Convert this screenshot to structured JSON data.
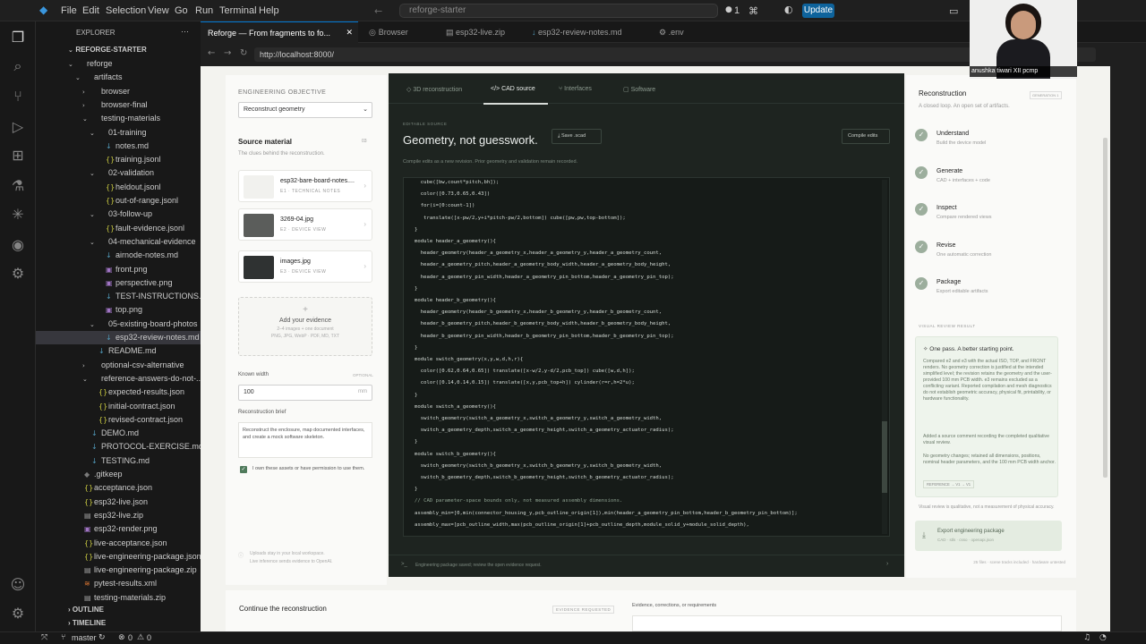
{
  "titlebar": {
    "menu": [
      "File",
      "Edit",
      "Selection",
      "View",
      "Go",
      "Run",
      "Terminal",
      "Help"
    ],
    "search": "reforge-starter",
    "badge": "1",
    "update": "Update"
  },
  "tabs": [
    {
      "label": "Reforge — From fragments to fo...",
      "active": true
    },
    {
      "label": "Browser",
      "active": false
    },
    {
      "label": "esp32-live.zip",
      "active": false
    },
    {
      "label": "esp32-review-notes.md",
      "active": false
    },
    {
      "label": ".env",
      "active": false
    }
  ],
  "browser": {
    "url": "http://localhost:8000/"
  },
  "explorer": {
    "title": "EXPLORER",
    "root": "REFORGE-STARTER",
    "items": [
      {
        "label": "reforge",
        "tw": "⌄",
        "icon": "",
        "indent": 0
      },
      {
        "label": "artifacts",
        "tw": "⌄",
        "icon": "",
        "indent": 1
      },
      {
        "label": "browser",
        "tw": "›",
        "icon": "",
        "indent": 2
      },
      {
        "label": "browser-final",
        "tw": "›",
        "icon": "",
        "indent": 2
      },
      {
        "label": "testing-materials",
        "tw": "⌄",
        "icon": "",
        "indent": 2
      },
      {
        "label": "01-training",
        "tw": "⌄",
        "icon": "",
        "indent": 3
      },
      {
        "label": "notes.md",
        "tw": "",
        "icon": "↓",
        "indent": 4
      },
      {
        "label": "training.jsonl",
        "tw": "",
        "icon": "{}",
        "indent": 4
      },
      {
        "label": "02-validation",
        "tw": "⌄",
        "icon": "",
        "indent": 3
      },
      {
        "label": "heldout.jsonl",
        "tw": "",
        "icon": "{}",
        "indent": 4
      },
      {
        "label": "out-of-range.jsonl",
        "tw": "",
        "icon": "{}",
        "indent": 4
      },
      {
        "label": "03-follow-up",
        "tw": "⌄",
        "icon": "",
        "indent": 3
      },
      {
        "label": "fault-evidence.jsonl",
        "tw": "",
        "icon": "{}",
        "indent": 4
      },
      {
        "label": "04-mechanical-evidence",
        "tw": "⌄",
        "icon": "",
        "indent": 3
      },
      {
        "label": "airnode-notes.md",
        "tw": "",
        "icon": "↓",
        "indent": 4
      },
      {
        "label": "front.png",
        "tw": "",
        "icon": "▣",
        "indent": 4
      },
      {
        "label": "perspective.png",
        "tw": "",
        "icon": "▣",
        "indent": 4
      },
      {
        "label": "TEST-INSTRUCTIONS.md",
        "tw": "",
        "icon": "↓",
        "indent": 4
      },
      {
        "label": "top.png",
        "tw": "",
        "icon": "▣",
        "indent": 4
      },
      {
        "label": "05-existing-board-photos",
        "tw": "⌄",
        "icon": "",
        "indent": 3
      },
      {
        "label": "esp32-review-notes.md",
        "tw": "",
        "icon": "↓",
        "indent": 4,
        "selected": true
      },
      {
        "label": "README.md",
        "tw": "",
        "icon": "↓",
        "indent": 3
      },
      {
        "label": "optional-csv-alternative",
        "tw": "›",
        "icon": "",
        "indent": 2
      },
      {
        "label": "reference-answers-do-not-...",
        "tw": "⌄",
        "icon": "",
        "indent": 2
      },
      {
        "label": "expected-results.json",
        "tw": "",
        "icon": "{}",
        "indent": 3
      },
      {
        "label": "initial-contract.json",
        "tw": "",
        "icon": "{}",
        "indent": 3
      },
      {
        "label": "revised-contract.json",
        "tw": "",
        "icon": "{}",
        "indent": 3
      },
      {
        "label": "DEMO.md",
        "tw": "",
        "icon": "↓",
        "indent": 2
      },
      {
        "label": "PROTOCOL-EXERCISE.md",
        "tw": "",
        "icon": "↓",
        "indent": 2
      },
      {
        "label": "TESTING.md",
        "tw": "",
        "icon": "↓",
        "indent": 2
      },
      {
        "label": ".gitkeep",
        "tw": "",
        "icon": "◆",
        "indent": 1
      },
      {
        "label": "acceptance.json",
        "tw": "",
        "icon": "{}",
        "indent": 1
      },
      {
        "label": "esp32-live.json",
        "tw": "",
        "icon": "{}",
        "indent": 1
      },
      {
        "label": "esp32-live.zip",
        "tw": "",
        "icon": "▤",
        "indent": 1
      },
      {
        "label": "esp32-render.png",
        "tw": "",
        "icon": "▣",
        "indent": 1
      },
      {
        "label": "live-acceptance.json",
        "tw": "",
        "icon": "{}",
        "indent": 1
      },
      {
        "label": "live-engineering-package.json",
        "tw": "",
        "icon": "{}",
        "indent": 1
      },
      {
        "label": "live-engineering-package.zip",
        "tw": "",
        "icon": "▤",
        "indent": 1
      },
      {
        "label": "pytest-results.xml",
        "tw": "",
        "icon": "≋",
        "indent": 1
      },
      {
        "label": "testing-materials.zip",
        "tw": "",
        "icon": "▤",
        "indent": 1
      }
    ],
    "outline": "OUTLINE",
    "timeline": "TIMELINE"
  },
  "status": {
    "branch": "master",
    "errors": "0",
    "warnings": "0"
  },
  "video": {
    "name": "anushka tiwari XII pcmp"
  },
  "left": {
    "objective_label": "ENGINEERING OBJECTIVE",
    "objective": "Reconstruct geometry",
    "source_title": "Source material",
    "source_count": "03",
    "source_desc": "The clues behind the reconstruction.",
    "files": [
      {
        "name": "esp32-bare-board-notes....",
        "meta": "E1 · TECHNICAL NOTES"
      },
      {
        "name": "3269-04.jpg",
        "meta": "E2 · DEVICE VIEW"
      },
      {
        "name": "images.jpg",
        "meta": "E3 · DEVICE VIEW"
      }
    ],
    "add_title": "Add your evidence",
    "add_hint1": "2–4 images + one document",
    "add_hint2": "PNG, JPG, WebP · PDF, MD, TXT",
    "width_label": "Known width",
    "width_opt": "OPTIONAL",
    "width_value": "100",
    "width_unit": "mm",
    "brief_label": "Reconstruction brief",
    "brief_text": "Reconstruct the enclosure, map documented interfaces, and create a mock software skeleton.",
    "consent": "I own these assets or have permission to use them.",
    "footer1": "Uploads stay in your local workspace.",
    "footer2": "Live inference sends evidence to OpenAI."
  },
  "center": {
    "tabs": [
      "3D reconstruction",
      "CAD source",
      "Interfaces",
      "Software"
    ],
    "active_tab": 1,
    "eyebrow": "EDITABLE SOURCE",
    "title": "Geometry, not guesswork.",
    "save": "Save .scad",
    "compile": "Compile edits",
    "desc": "Compile edits as a new revision. Prior geometry and validation remain recorded.",
    "code": [
      "  cube([bw,count*pitch,bh]);",
      "  color([0.73,0.65,0.43])",
      "  for(i=[0:count-1])",
      "   translate([x-pw/2,y+i*pitch-pw/2,bottom]) cube([pw,pw,top-bottom]);",
      "}",
      "module header_a_geometry(){",
      "  header_geometry(header_a_geometry_x,header_a_geometry_y,header_a_geometry_count,",
      "  header_a_geometry_pitch,header_a_geometry_body_width,header_a_geometry_body_height,",
      "  header_a_geometry_pin_width,header_a_geometry_pin_bottom,header_a_geometry_pin_top);",
      "}",
      "module header_b_geometry(){",
      "  header_geometry(header_b_geometry_x,header_b_geometry_y,header_b_geometry_count,",
      "  header_b_geometry_pitch,header_b_geometry_body_width,header_b_geometry_body_height,",
      "  header_b_geometry_pin_width,header_b_geometry_pin_bottom,header_b_geometry_pin_top);",
      "}",
      "module switch_geometry(x,y,w,d,h,r){",
      "  color([0.62,0.64,0.65]) translate([x-w/2,y-d/2,pcb_top]) cube([w,d,h]);",
      "  color([0.14,0.14,0.15]) translate([x,y,pcb_top+h]) cylinder(r=r,h=2*u);",
      "}",
      "module switch_a_geometry(){",
      "  switch_geometry(switch_a_geometry_x,switch_a_geometry_y,switch_a_geometry_width,",
      "  switch_a_geometry_depth,switch_a_geometry_height,switch_a_geometry_actuator_radius);",
      "}",
      "module switch_b_geometry(){",
      "  switch_geometry(switch_b_geometry_x,switch_b_geometry_y,switch_b_geometry_width,",
      "  switch_b_geometry_depth,switch_b_geometry_height,switch_b_geometry_actuator_radius);",
      "}",
      "// CAD parameter-space bounds only, not measured assembly dimensions.",
      "assembly_min=[0,min(connector_housing_y,pcb_outline_origin[1]),min(header_a_geometry_pin_bottom,header_b_geometry_pin_bottom)];",
      "assembly_max=[pcb_outline_width,max(pcb_outline_origin[1]+pcb_outline_depth,module_solid_y+module_solid_depth),"
    ],
    "footer": "Engineering package saved; review the open evidence request."
  },
  "right": {
    "title": "Reconstruction",
    "gen": "GENERATION 1",
    "subtitle": "A closed loop. An open set of artifacts.",
    "steps": [
      {
        "title": "Understand",
        "desc": "Build the device model"
      },
      {
        "title": "Generate",
        "desc": "CAD + interfaces + code"
      },
      {
        "title": "Inspect",
        "desc": "Compare rendered views"
      },
      {
        "title": "Revise",
        "desc": "One automatic correction"
      },
      {
        "title": "Package",
        "desc": "Export editable artifacts"
      }
    ],
    "vr_label": "VISUAL REVIEW RESULT",
    "vr_title": "One pass. A better starting point.",
    "vr_body": "Compared e2 and e3 with the actual ISO, TOP, and FRONT renders. No geometry correction is justified at the intended simplified level; the revision retains the geometry and the user-provided 100 mm PCB width. e3 remains excluded as a conflicting variant. Reported compilation and mesh diagnostics do not establish geometric accuracy, physical fit, printability, or hardware functionality.",
    "vr_body2": "Added a source comment recording the completed qualitative visual review.",
    "vr_body3": "No geometry changes; retained all dimensions, positions, nominal header parameters, and the 100 mm PCB width anchor.",
    "vr_ref": "REFERENCE → V1 → V1",
    "note": "Visual review is qualitative, not a measurement of physical accuracy.",
    "export_title": "Export engineering package",
    "export_sub": "CAD · stls · csso · openapi.json",
    "files_note": "25 files · scene tracks included · hardware untested"
  },
  "bottom": {
    "title": "Continue the reconstruction",
    "badge": "EVIDENCE REQUESTED",
    "label": "Evidence, corrections, or requirements"
  }
}
